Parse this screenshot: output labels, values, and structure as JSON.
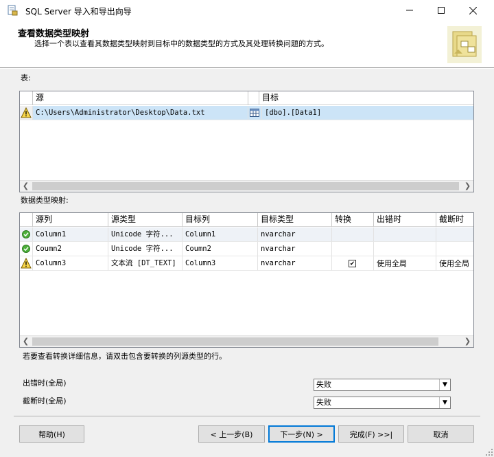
{
  "window": {
    "title": "SQL Server 导入和导出向导"
  },
  "header": {
    "title": "查看数据类型映射",
    "subtitle": "选择一个表以查看其数据类型映射到目标中的数据类型的方式及其处理转换问题的方式。"
  },
  "tables": {
    "label": "表:",
    "columns": [
      "源",
      "目标"
    ],
    "rows": [
      {
        "source": "C:\\Users\\Administrator\\Desktop\\Data.txt",
        "destination": "[dbo].[Data1]",
        "status_icon": "warning-icon"
      }
    ]
  },
  "mapping": {
    "label": "数据类型映射:",
    "columns": [
      "源列",
      "源类型",
      "目标列",
      "目标类型",
      "转换",
      "出错时",
      "截断时"
    ],
    "rows": [
      {
        "status_icon": "ok-icon",
        "source_col": "Column1",
        "source_type": "Unicode 字符...",
        "dest_col": "Column1",
        "dest_type": "nvarchar",
        "convert": false,
        "on_error": "",
        "on_truncate": ""
      },
      {
        "status_icon": "ok-icon",
        "source_col": "Coumn2",
        "source_type": "Unicode 字符...",
        "dest_col": "Coumn2",
        "dest_type": "nvarchar",
        "convert": false,
        "on_error": "",
        "on_truncate": ""
      },
      {
        "status_icon": "warning-icon",
        "source_col": "Column3",
        "source_type": "文本流 [DT_TEXT]",
        "dest_col": "Column3",
        "dest_type": "nvarchar",
        "convert": true,
        "on_error": "使用全局",
        "on_truncate": "使用全局"
      }
    ]
  },
  "hint": "若要查看转换详细信息，请双击包含要转换的列源类型的行。",
  "global": {
    "on_error_label": "出错时(全局)",
    "on_error_value": "失败",
    "on_truncate_label": "截断时(全局)",
    "on_truncate_value": "失败"
  },
  "buttons": {
    "help": "帮助(H)",
    "back": "< 上一步(B)",
    "next": "下一步(N) >",
    "finish": "完成(F) >>|",
    "cancel": "取消"
  }
}
